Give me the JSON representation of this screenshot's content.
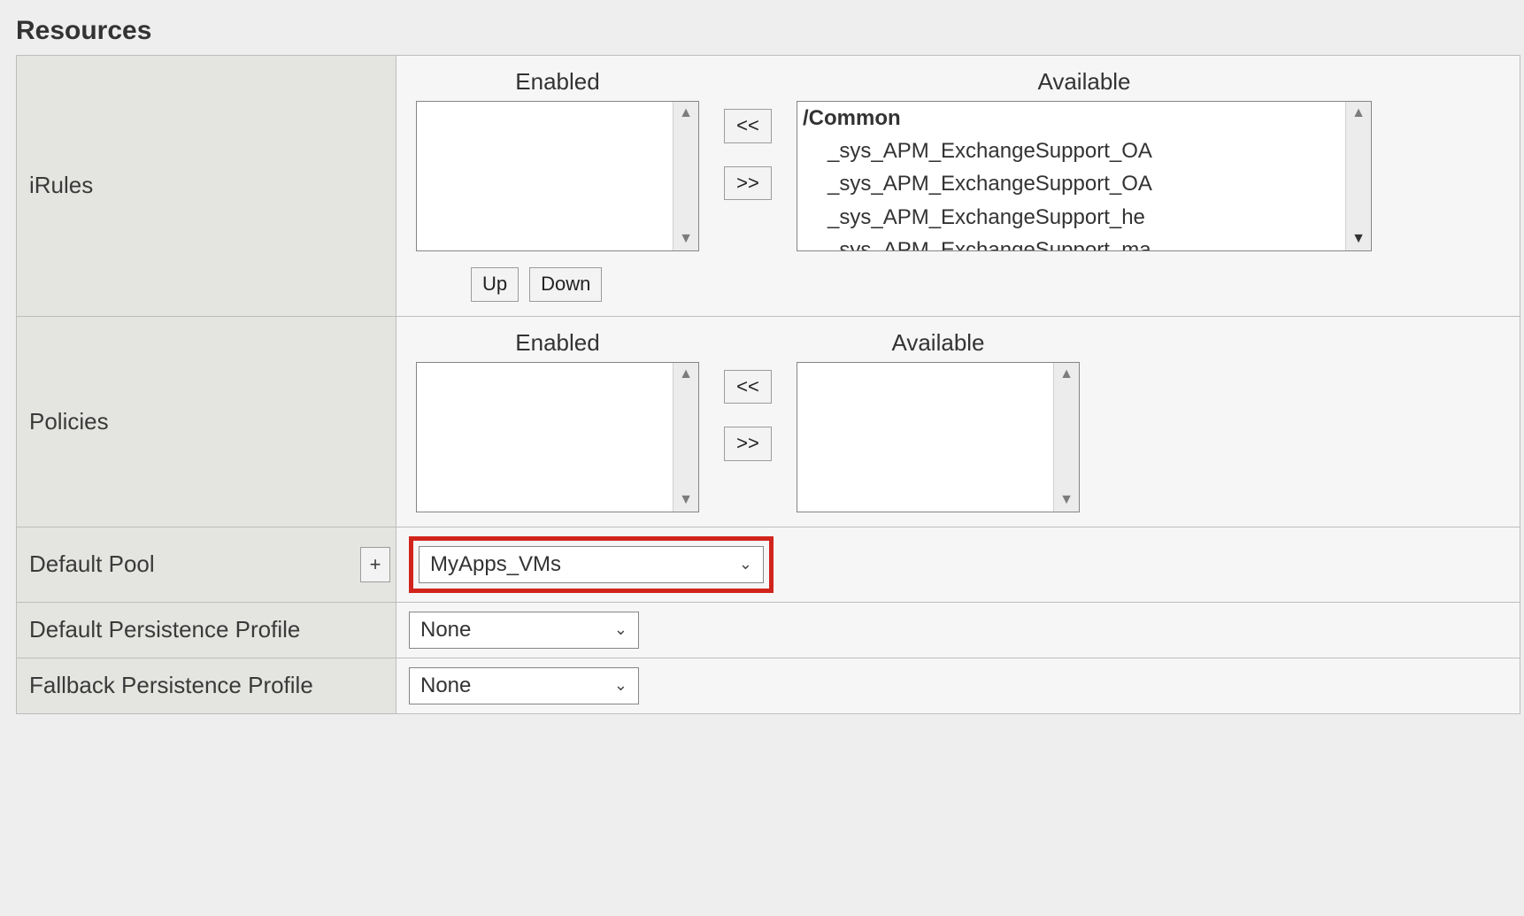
{
  "section_title": "Resources",
  "labels": {
    "enabled": "Enabled",
    "available": "Available"
  },
  "buttons": {
    "move_left": "<<",
    "move_right": ">>",
    "up": "Up",
    "down": "Down",
    "plus": "+"
  },
  "rows": {
    "irules": {
      "label": "iRules",
      "enabled_items": [],
      "available_group": "/Common",
      "available_items": [
        "_sys_APM_ExchangeSupport_OA",
        "_sys_APM_ExchangeSupport_OA",
        "_sys_APM_ExchangeSupport_he",
        "_sys_APM_ExchangeSupport_ma"
      ]
    },
    "policies": {
      "label": "Policies",
      "enabled_items": [],
      "available_items": []
    },
    "default_pool": {
      "label": "Default Pool",
      "value": "MyApps_VMs"
    },
    "default_persistence": {
      "label": "Default Persistence Profile",
      "value": "None"
    },
    "fallback_persistence": {
      "label": "Fallback Persistence Profile",
      "value": "None"
    }
  }
}
